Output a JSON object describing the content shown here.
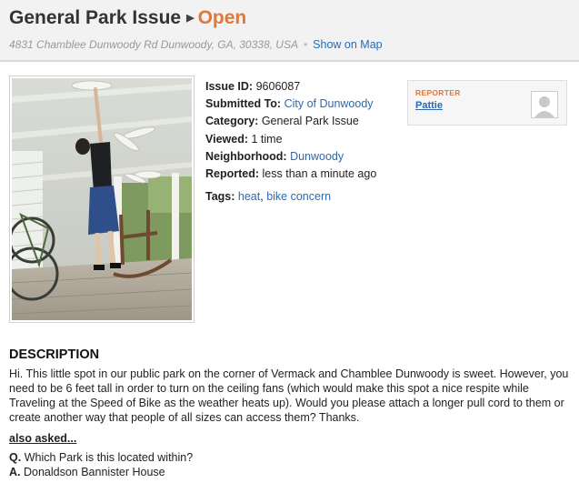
{
  "header": {
    "category": "General Park Issue",
    "status": "Open",
    "address": "4831 Chamblee Dunwoody Rd Dunwoody, GA, 30338, USA",
    "show_map": "Show on Map"
  },
  "details": {
    "issue_id_label": "Issue ID:",
    "issue_id": "9606087",
    "submitted_to_label": "Submitted To:",
    "submitted_to": "City of Dunwoody",
    "category_label": "Category:",
    "category": "General Park Issue",
    "viewed_label": "Viewed:",
    "viewed": "1 time",
    "neighborhood_label": "Neighborhood:",
    "neighborhood": "Dunwoody",
    "reported_label": "Reported:",
    "reported": "less than a minute ago",
    "tags_label": "Tags:",
    "tags": [
      "heat",
      "bike concern"
    ]
  },
  "reporter": {
    "label": "REPORTER",
    "name": "Pattie"
  },
  "description": {
    "heading": "DESCRIPTION",
    "text": "Hi. This little spot in our public park on the corner of Vermack and Chamblee Dunwoody is sweet. However, you need to be 6 feet tall in order to turn on the ceiling fans (which would make this spot a nice respite while Traveling at the Speed of Bike as the weather heats up). Would you please attach a longer pull cord to them or create another way that people of all sizes can access them? Thanks."
  },
  "also_asked": {
    "label": "also asked...",
    "q_label": "Q.",
    "question": "Which Park is this located within?",
    "a_label": "A.",
    "answer": "Donaldson Bannister House"
  },
  "colors": {
    "status": "#e0783c",
    "link": "#2a6ab4",
    "header_bg": "#f2f2f2"
  }
}
